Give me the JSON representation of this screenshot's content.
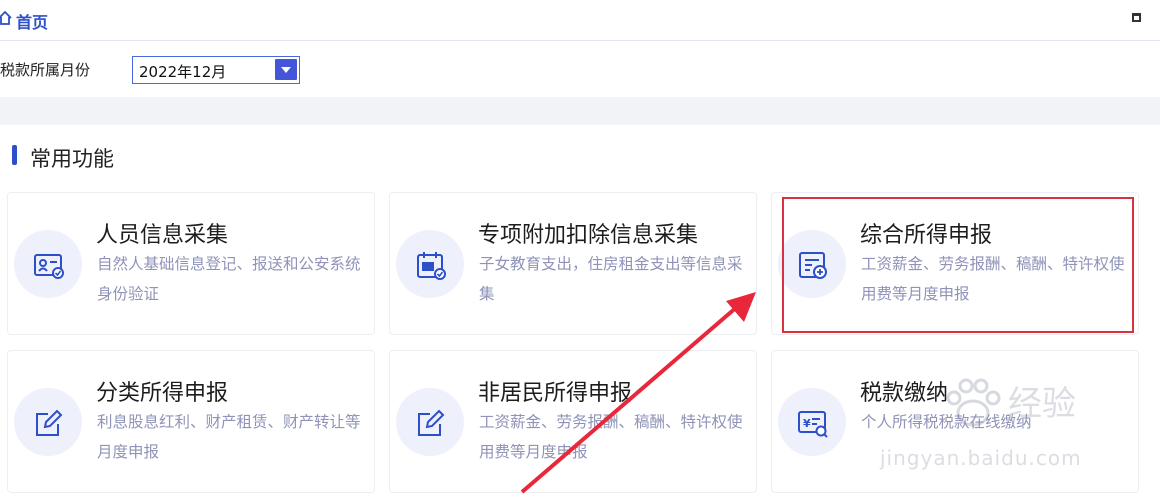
{
  "header": {
    "home_label": "首页"
  },
  "filter": {
    "month_label": "税款所属月份",
    "month_value": "2022年12月"
  },
  "section": {
    "title": "常用功能"
  },
  "cards": [
    {
      "title": "人员信息采集",
      "desc": "自然人基础信息登记、报送和公安系统身份验证",
      "icon": "person-id-card-icon"
    },
    {
      "title": "专项附加扣除信息采集",
      "desc": "子女教育支出，住房租金支出等信息采集",
      "icon": "tax-calendar-icon"
    },
    {
      "title": "综合所得申报",
      "desc": "工资薪金、劳务报酬、稿酬、特许权使用费等月度申报",
      "icon": "declaration-form-icon"
    },
    {
      "title": "分类所得申报",
      "desc": "利息股息红利、财产租赁、财产转让等月度申报",
      "icon": "edit-form-icon"
    },
    {
      "title": "非居民所得申报",
      "desc": "工资薪金、劳务报酬、稿酬、特许权使用费等月度申报",
      "icon": "edit-form-icon"
    },
    {
      "title": "税款缴纳",
      "desc": "个人所得税税款在线缴纳",
      "icon": "tax-payment-icon"
    }
  ],
  "watermark": {
    "cn": "经验",
    "en": "jingyan.baidu.com"
  },
  "colors": {
    "accent": "#2d4fc9",
    "highlight": "#d9323f",
    "icon_bg": "#eef0fb"
  }
}
